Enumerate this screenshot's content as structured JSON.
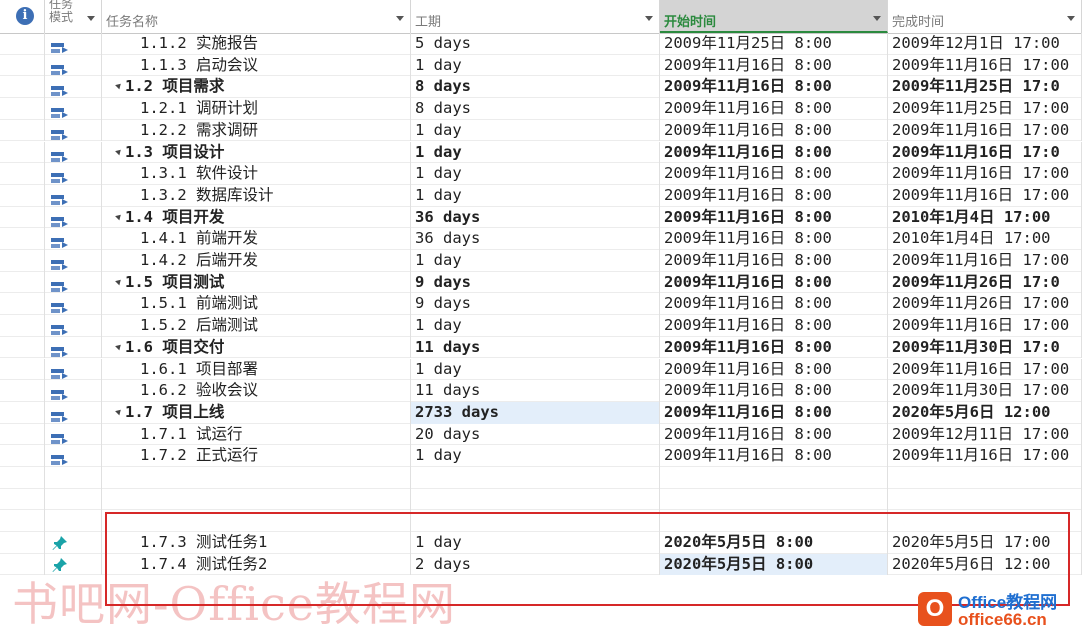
{
  "header": {
    "info_icon": "i",
    "mode_label_line1": "任务",
    "mode_label_line2": "模式",
    "name_label": "任务名称",
    "duration_label": "工期",
    "start_label": "开始时间",
    "finish_label": "完成时间"
  },
  "colors": {
    "accent_green": "#2b8a3e",
    "highlight_blue": "#e3eefa",
    "red_box": "#d62828",
    "mode_icon_blue": "#3d6fb5",
    "pin_teal": "#1aa3a8"
  },
  "rows": [
    {
      "mode": "auto-schedule-icon",
      "name": "1.1.2 实施报告",
      "duration": "5 days",
      "start": "2009年11月25日 8:00",
      "finish": "2009年12月1日 17:00",
      "level": 3,
      "summary": false
    },
    {
      "mode": "auto-schedule-icon",
      "name": "1.1.3 启动会议",
      "duration": "1 day",
      "start": "2009年11月16日 8:00",
      "finish": "2009年11月16日 17:00",
      "level": 3,
      "summary": false
    },
    {
      "mode": "auto-schedule-icon",
      "name": "1.2 项目需求",
      "duration": "8 days",
      "start": "2009年11月16日 8:00",
      "finish": "2009年11月25日 17:0",
      "level": 2,
      "summary": true
    },
    {
      "mode": "auto-schedule-icon",
      "name": "1.2.1 调研计划",
      "duration": "8 days",
      "start": "2009年11月16日 8:00",
      "finish": "2009年11月25日 17:00",
      "level": 3,
      "summary": false
    },
    {
      "mode": "auto-schedule-icon",
      "name": "1.2.2 需求调研",
      "duration": "1 day",
      "start": "2009年11月16日 8:00",
      "finish": "2009年11月16日 17:00",
      "level": 3,
      "summary": false
    },
    {
      "mode": "auto-schedule-icon",
      "name": "1.3 项目设计",
      "duration": "1 day",
      "start": "2009年11月16日 8:00",
      "finish": "2009年11月16日 17:0",
      "level": 2,
      "summary": true
    },
    {
      "mode": "auto-schedule-icon",
      "name": "1.3.1 软件设计",
      "duration": "1 day",
      "start": "2009年11月16日 8:00",
      "finish": "2009年11月16日 17:00",
      "level": 3,
      "summary": false
    },
    {
      "mode": "auto-schedule-icon",
      "name": "1.3.2 数据库设计",
      "duration": "1 day",
      "start": "2009年11月16日 8:00",
      "finish": "2009年11月16日 17:00",
      "level": 3,
      "summary": false
    },
    {
      "mode": "auto-schedule-icon",
      "name": "1.4 项目开发",
      "duration": "36 days",
      "start": "2009年11月16日 8:00",
      "finish": "2010年1月4日 17:00",
      "level": 2,
      "summary": true
    },
    {
      "mode": "auto-schedule-icon",
      "name": "1.4.1 前端开发",
      "duration": "36 days",
      "start": "2009年11月16日 8:00",
      "finish": "2010年1月4日 17:00",
      "level": 3,
      "summary": false
    },
    {
      "mode": "auto-schedule-icon",
      "name": "1.4.2 后端开发",
      "duration": "1 day",
      "start": "2009年11月16日 8:00",
      "finish": "2009年11月16日 17:00",
      "level": 3,
      "summary": false
    },
    {
      "mode": "auto-schedule-icon",
      "name": "1.5 项目测试",
      "duration": "9 days",
      "start": "2009年11月16日 8:00",
      "finish": "2009年11月26日 17:0",
      "level": 2,
      "summary": true
    },
    {
      "mode": "auto-schedule-icon",
      "name": "1.5.1 前端测试",
      "duration": "9 days",
      "start": "2009年11月16日 8:00",
      "finish": "2009年11月26日 17:00",
      "level": 3,
      "summary": false
    },
    {
      "mode": "auto-schedule-icon",
      "name": "1.5.2 后端测试",
      "duration": "1 day",
      "start": "2009年11月16日 8:00",
      "finish": "2009年11月16日 17:00",
      "level": 3,
      "summary": false
    },
    {
      "mode": "auto-schedule-icon",
      "name": "1.6 项目交付",
      "duration": "11 days",
      "start": "2009年11月16日 8:00",
      "finish": "2009年11月30日 17:0",
      "level": 2,
      "summary": true
    },
    {
      "mode": "auto-schedule-icon",
      "name": "1.6.1 项目部署",
      "duration": "1 day",
      "start": "2009年11月16日 8:00",
      "finish": "2009年11月16日 17:00",
      "level": 3,
      "summary": false
    },
    {
      "mode": "auto-schedule-icon",
      "name": "1.6.2 验收会议",
      "duration": "11 days",
      "start": "2009年11月16日 8:00",
      "finish": "2009年11月30日 17:00",
      "level": 3,
      "summary": false
    },
    {
      "mode": "auto-schedule-icon",
      "name": "1.7 项目上线",
      "duration": "2733 days",
      "start": "2009年11月16日 8:00",
      "finish": "2020年5月6日 12:00",
      "level": 2,
      "summary": true,
      "duration_highlight": true
    },
    {
      "mode": "auto-schedule-icon",
      "name": "1.7.1 试运行",
      "duration": "20 days",
      "start": "2009年11月16日 8:00",
      "finish": "2009年12月11日 17:00",
      "level": 3,
      "summary": false
    },
    {
      "mode": "auto-schedule-icon",
      "name": "1.7.2 正式运行",
      "duration": "1 day",
      "start": "2009年11月16日 8:00",
      "finish": "2009年11月16日 17:00",
      "level": 3,
      "summary": false
    },
    {
      "mode": "",
      "name": "",
      "duration": "",
      "start": "",
      "finish": "",
      "level": 3,
      "summary": false
    },
    {
      "mode": "",
      "name": "",
      "duration": "",
      "start": "",
      "finish": "",
      "level": 3,
      "summary": false
    },
    {
      "mode": "",
      "name": "",
      "duration": "",
      "start": "",
      "finish": "",
      "level": 3,
      "summary": false
    },
    {
      "mode": "manual-schedule-pin-icon",
      "name": "1.7.3 测试任务1",
      "duration": "1 day",
      "start": "2020年5月5日 8:00",
      "finish": "2020年5月5日 17:00",
      "level": 3,
      "summary": false,
      "start_bold": true
    },
    {
      "mode": "manual-schedule-pin-icon",
      "name": "1.7.4 测试任务2",
      "duration": "2 days",
      "start": "2020年5月5日 8:00",
      "finish": "2020年5月6日 12:00",
      "level": 3,
      "summary": false,
      "start_bold": true,
      "start_highlight": true
    }
  ],
  "watermark": "书吧网-Office教程网",
  "logo": {
    "glyph": "O",
    "line1": "Office教程网",
    "line2": "office66.cn"
  }
}
